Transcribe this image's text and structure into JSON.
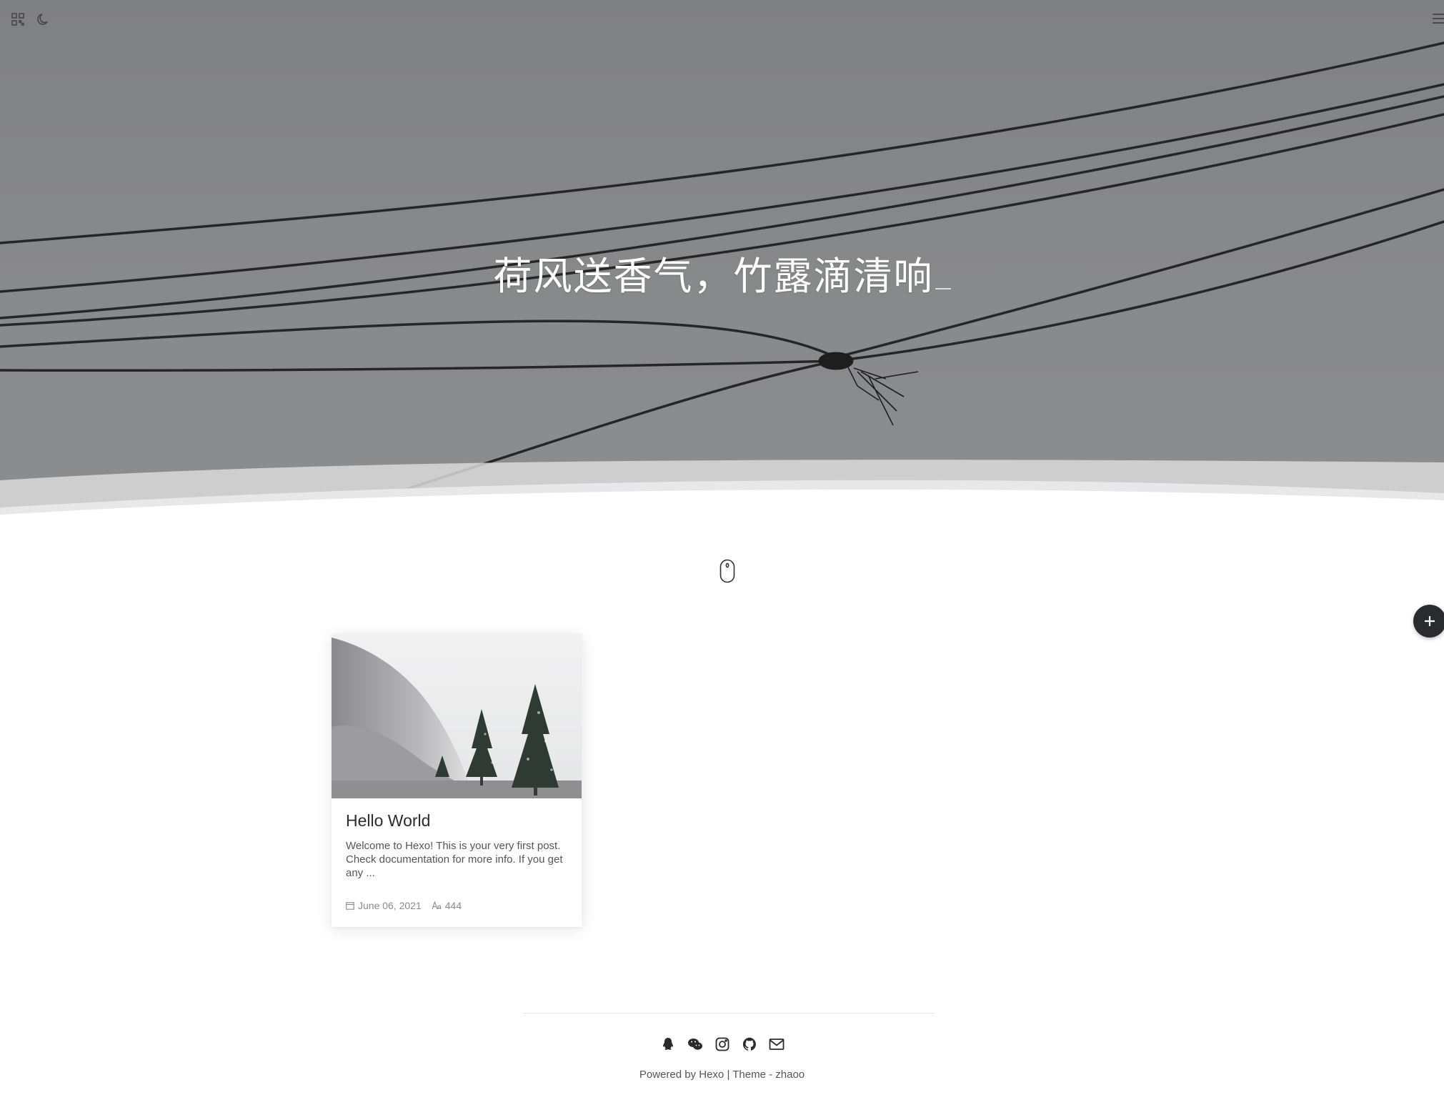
{
  "hero": {
    "title": "荷风送香气，竹露滴清响",
    "background_color": "#87888a"
  },
  "toolbar": {
    "icons": [
      "qrcode-icon",
      "moon-icon",
      "menu-icon"
    ]
  },
  "scroll_hint": {
    "icon": "mouse-icon"
  },
  "fab": {
    "label": "+"
  },
  "posts": [
    {
      "title": "Hello World",
      "excerpt": "Welcome to Hexo! This is your very first post. Check documentation for more info. If you get any ...",
      "date": "June 06, 2021",
      "word_count": "444"
    }
  ],
  "footer": {
    "social_icons": [
      "qq-icon",
      "wechat-icon",
      "instagram-icon",
      "github-icon",
      "mail-icon"
    ],
    "powered_prefix": "Powered by",
    "powered_link": "Hexo",
    "separator": "|",
    "theme_text": "Theme - zhaoo"
  }
}
